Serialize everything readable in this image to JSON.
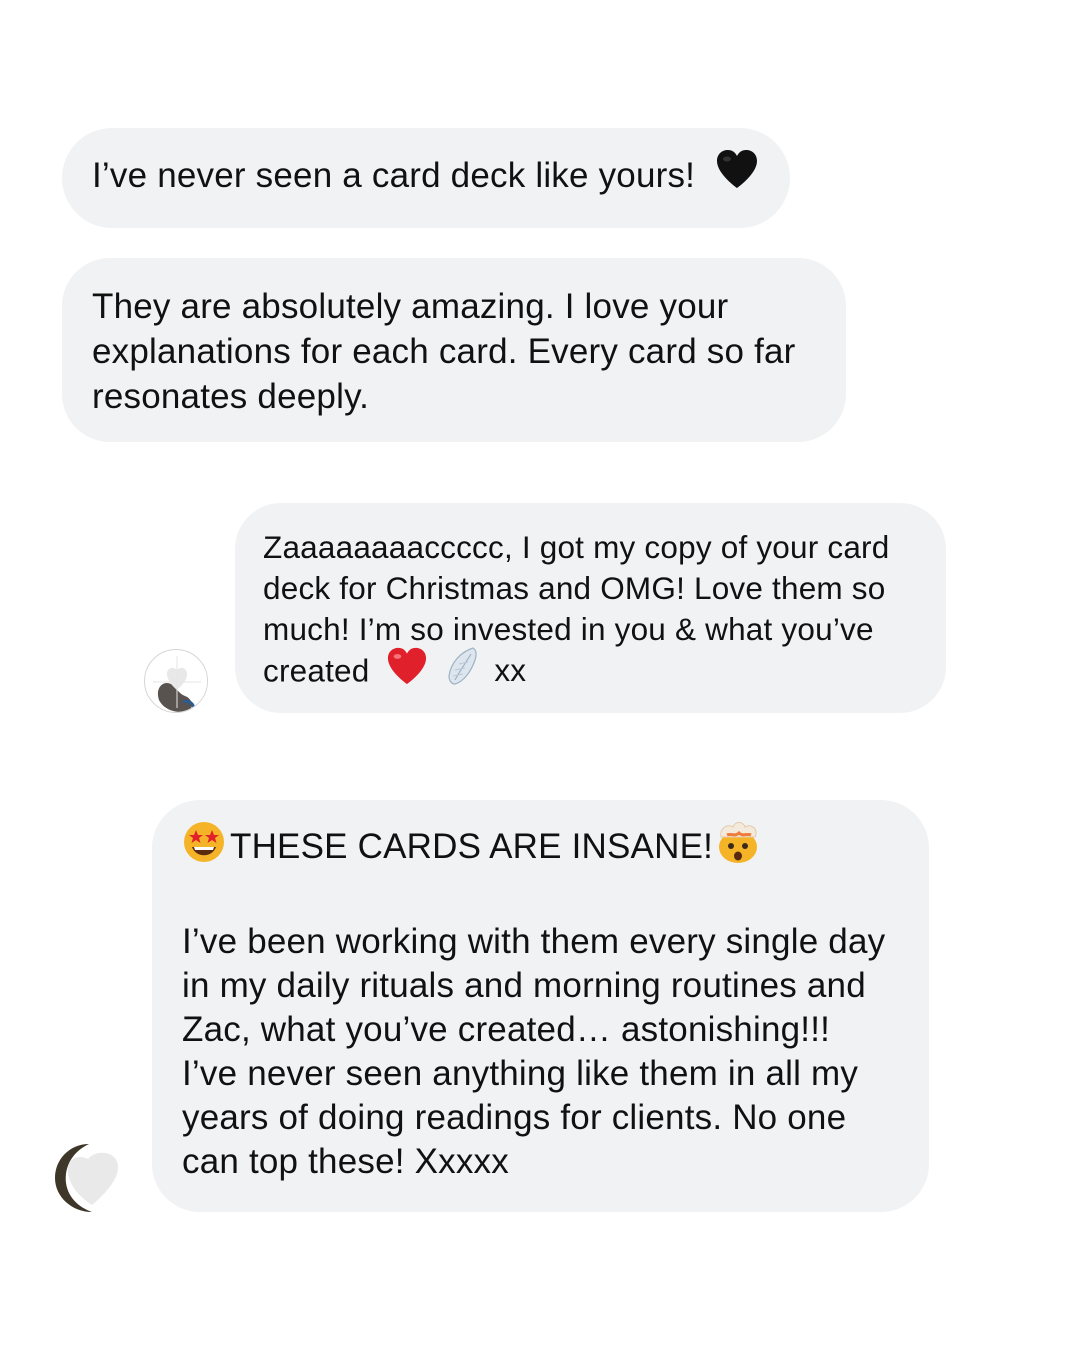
{
  "messages": [
    {
      "text": "I’ve never seen a card deck like yours!",
      "emoji": "black-heart"
    },
    {
      "lines": [
        "They are absolutely amazing. I love your",
        "explanations for each card. Every card so far",
        "resonates deeply."
      ]
    },
    {
      "lines": [
        "Zaaaaaaaaccccc, I got my copy of your card",
        "deck for Christmas and OMG! Love them so",
        "much! I’m so invested in you & what you’ve"
      ],
      "last_line_start": "created",
      "last_line_end": "xx",
      "emojis": [
        "red-heart",
        "wing"
      ]
    },
    {
      "headline": "THESE CARDS ARE INSANE!",
      "headline_emojis": [
        "star-struck-face",
        "exploding-head"
      ],
      "lines": [
        "I’ve been working with them every single day",
        "in my daily rituals and morning routines and",
        "Zac, what you’ve created… astonishing!!!",
        "I’ve never seen anything like them in all my",
        "years of doing readings for clients. No one",
        "can top these! Xxxxx"
      ]
    }
  ],
  "avatars": [
    "profile-avatar",
    "profile-avatar"
  ],
  "colors": {
    "bubble": "#f1f2f4",
    "text": "#111111",
    "red_heart": "#e0202a",
    "black_heart": "#111111",
    "emoji_face": "#f5b427"
  }
}
